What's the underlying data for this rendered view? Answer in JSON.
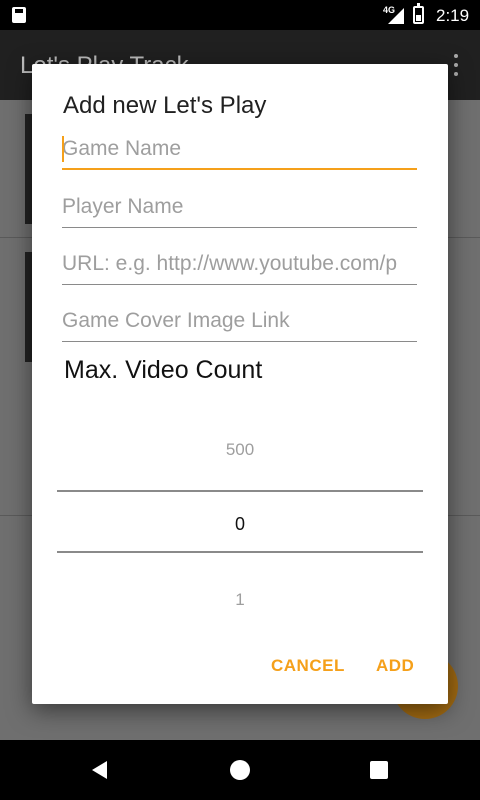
{
  "status_bar": {
    "network": "4G",
    "time": "2:19",
    "icons": [
      "sd-card-icon",
      "signal-icon",
      "battery-icon"
    ]
  },
  "app_bar": {
    "title": "Let's Play Track",
    "menu_icon": "overflow-menu-icon"
  },
  "dialog": {
    "title": "Add new Let's Play",
    "fields": {
      "game_name": {
        "placeholder": "Game Name",
        "value": ""
      },
      "player_name": {
        "placeholder": "Player Name",
        "value": ""
      },
      "url": {
        "placeholder": "URL: e.g. http://www.youtube.com/p",
        "value": ""
      },
      "cover": {
        "placeholder": "Game Cover Image Link",
        "value": ""
      }
    },
    "count_label": "Max. Video Count",
    "picker": {
      "above": "500",
      "selected": "0",
      "below": "1"
    },
    "buttons": {
      "cancel": "CANCEL",
      "add": "ADD"
    }
  },
  "colors": {
    "accent": "#f5a01a",
    "scrim": "#6f6f6f",
    "app_bar": "#202020"
  },
  "nav_bar": {
    "icons": [
      "back-icon",
      "home-icon",
      "recents-icon"
    ]
  }
}
